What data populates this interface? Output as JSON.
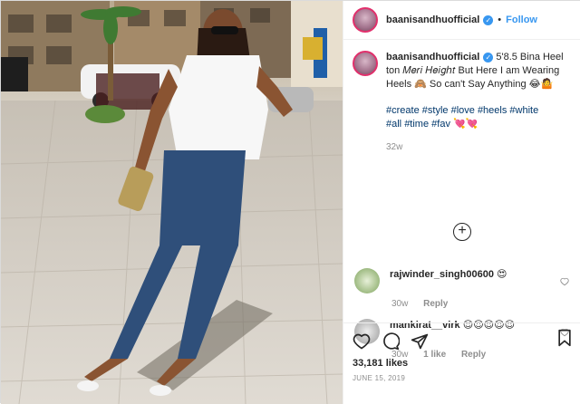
{
  "post": {
    "username": "baanisandhuofficial",
    "follow_label": "Follow",
    "dot": "•",
    "caption": {
      "username": "baanisandhuofficial",
      "text": " 5'8.5 Bina Heel ton 𝑀𝑒𝑟𝑖 𝐻𝑒𝑖𝑔ℎ𝑡 But Here I am Wearing Heels 🙈 So can't Say Anything 😂🤷",
      "hashtags": [
        "#create",
        "#style",
        "#love",
        "#heels",
        "#white",
        "#all",
        "#time",
        "#fav",
        "💘💘"
      ]
    },
    "caption_age": "32w",
    "load_more_symbol": "+",
    "comments": [
      {
        "username": "rajwinder_singh00600",
        "text": "😍",
        "age": "30w",
        "likes": "",
        "reply": "Reply"
      },
      {
        "username": "mankirat__virk",
        "text": "😍😍😍😍😍",
        "age": "30w",
        "likes": "1 like",
        "reply": "Reply"
      }
    ],
    "likes": "33,181 likes",
    "date": "JUNE 15, 2019"
  },
  "icons": {
    "verified": "verified-badge-icon",
    "heart": "heart-icon",
    "comment": "comment-icon",
    "share": "share-icon",
    "bookmark": "bookmark-icon"
  },
  "colors": {
    "link": "#3897f0",
    "hashtag": "#00376b",
    "muted": "#8e8e8e",
    "border": "#dbdbdb"
  }
}
